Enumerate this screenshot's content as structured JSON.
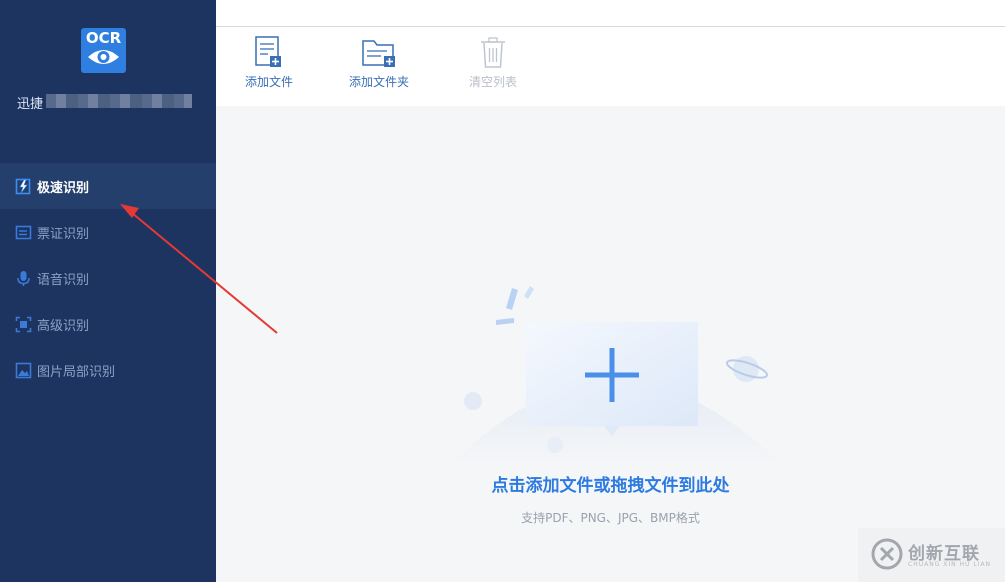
{
  "app": {
    "logo_text": "OCR",
    "name": "迅捷"
  },
  "sidebar": {
    "items": [
      {
        "label": "极速识别",
        "icon": "lightning-doc-icon",
        "active": true
      },
      {
        "label": "票证识别",
        "icon": "card-icon",
        "active": false
      },
      {
        "label": "语音识别",
        "icon": "microphone-icon",
        "active": false
      },
      {
        "label": "高级识别",
        "icon": "scan-frame-icon",
        "active": false
      },
      {
        "label": "图片局部识别",
        "icon": "image-crop-icon",
        "active": false
      }
    ]
  },
  "toolbar": {
    "add_file_label": "添加文件",
    "add_folder_label": "添加文件夹",
    "clear_list_label": "清空列表"
  },
  "dropzone": {
    "hint": "点击添加文件或拖拽文件到此处",
    "formats": "支持PDF、PNG、JPG、BMP格式"
  },
  "watermark": {
    "text": "创新互联",
    "sub": "CHUANG XIN HU LIAN"
  },
  "colors": {
    "sidebar_bg": "#1d3461",
    "accent": "#2d7be0"
  }
}
